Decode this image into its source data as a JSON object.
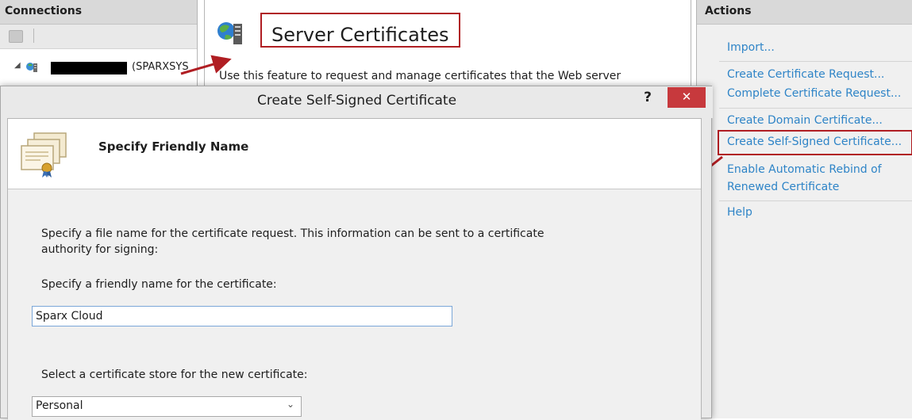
{
  "connections": {
    "header": "Connections",
    "server_label": "(SPARXSYS"
  },
  "center": {
    "feature_title": "Server Certificates",
    "feature_description": "Use this feature to request and manage certificates that the Web server"
  },
  "actions": {
    "header": "Actions",
    "items": [
      "Import...",
      "Create Certificate Request...",
      "Complete Certificate Request...",
      "Create Domain Certificate...",
      "Create Self-Signed Certificate...",
      "Enable Automatic Rebind of",
      "Renewed Certificate",
      "Help"
    ]
  },
  "dialog": {
    "title": "Create Self-Signed Certificate",
    "help_label": "?",
    "close_label": "✕",
    "step_title": "Specify Friendly Name",
    "description_line1": "Specify a file name for the certificate request.  This information can be sent to a certificate",
    "description_line2": "authority for signing:",
    "friendly_name_label": "Specify a friendly name for the certificate:",
    "friendly_name_value": "Sparx Cloud",
    "store_label": "Select a certificate store for the new certificate:",
    "store_value": "Personal"
  },
  "colors": {
    "link": "#2e84c7",
    "highlight_red": "#b01e23",
    "close_button": "#c7393d"
  },
  "icons": [
    "server-icon",
    "certificate-icon",
    "certificates-stack-icon",
    "chevron-down-icon",
    "close-icon",
    "help-icon"
  ]
}
